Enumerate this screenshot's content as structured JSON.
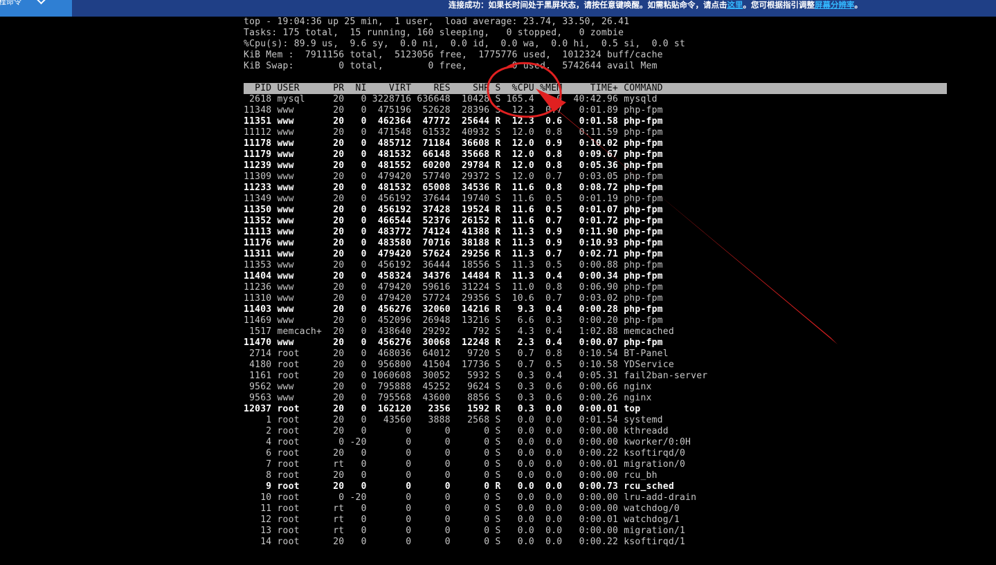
{
  "toolbar": {
    "command_button_label": "程命令",
    "notice_text": "连接成功：如果长时间处于黑屏状态，请按任意键唤醒。如需粘贴命令，请点击",
    "notice_link_here": "这里",
    "notice_mid": "。您可根据指引调整",
    "notice_link_resolution": "屏幕分辨率",
    "notice_end": "。"
  },
  "summary": [
    "top - 19:04:36 up 25 min,  1 user,  load average: 23.74, 33.50, 26.41",
    "Tasks: 175 total,  15 running, 160 sleeping,   0 stopped,   0 zombie",
    "%Cpu(s): 89.9 us,  9.6 sy,  0.0 ni,  0.0 id,  0.0 wa,  0.0 hi,  0.5 si,  0.0 st",
    "KiB Mem :  7911156 total,  5123056 free,  1775776 used,  1012324 buff/cache",
    "KiB Swap:        0 total,        0 free,        0 used.  5742644 avail Mem"
  ],
  "process_header": "  PID USER      PR  NI    VIRT    RES    SHR S  %CPU %MEM     TIME+ COMMAND",
  "processes": [
    {
      "text": " 2618 mysql     20   0 3228716 636648  10428 S 165.4  8.0  40:42.96 mysqld",
      "bold": false
    },
    {
      "text": "11348 www       20   0  475196  52628  28396 S  12.3  0.7   0:01.89 php-fpm",
      "bold": false
    },
    {
      "text": "11351 www       20   0  462364  47772  25644 R  12.3  0.6   0:01.58 php-fpm",
      "bold": true
    },
    {
      "text": "11112 www       20   0  471548  61532  40932 S  12.0  0.8   0:11.59 php-fpm",
      "bold": false
    },
    {
      "text": "11178 www       20   0  485712  71184  36608 R  12.0  0.9   0:10.02 php-fpm",
      "bold": true
    },
    {
      "text": "11179 www       20   0  481532  66148  35668 R  12.0  0.8   0:09.67 php-fpm",
      "bold": true
    },
    {
      "text": "11239 www       20   0  481552  60200  29784 R  12.0  0.8   0:05.36 php-fpm",
      "bold": true
    },
    {
      "text": "11309 www       20   0  479420  57740  29372 S  12.0  0.7   0:03.05 php-fpm",
      "bold": false
    },
    {
      "text": "11233 www       20   0  481532  65008  34536 R  11.6  0.8   0:08.72 php-fpm",
      "bold": true
    },
    {
      "text": "11349 www       20   0  456192  37644  19740 S  11.6  0.5   0:01.19 php-fpm",
      "bold": false
    },
    {
      "text": "11350 www       20   0  456192  37428  19524 R  11.6  0.5   0:01.07 php-fpm",
      "bold": true
    },
    {
      "text": "11352 www       20   0  466544  52376  26152 R  11.6  0.7   0:01.72 php-fpm",
      "bold": true
    },
    {
      "text": "11113 www       20   0  483772  74124  41388 R  11.3  0.9   0:11.90 php-fpm",
      "bold": true
    },
    {
      "text": "11176 www       20   0  483580  70716  38188 R  11.3  0.9   0:10.93 php-fpm",
      "bold": true
    },
    {
      "text": "11311 www       20   0  479420  57624  29256 R  11.3  0.7   0:02.71 php-fpm",
      "bold": true
    },
    {
      "text": "11353 www       20   0  456192  36444  18556 S  11.3  0.5   0:00.88 php-fpm",
      "bold": false
    },
    {
      "text": "11404 www       20   0  458324  34376  14484 R  11.3  0.4   0:00.34 php-fpm",
      "bold": true
    },
    {
      "text": "11236 www       20   0  479420  59616  31224 S  11.0  0.8   0:06.90 php-fpm",
      "bold": false
    },
    {
      "text": "11310 www       20   0  479420  57724  29356 S  10.6  0.7   0:03.02 php-fpm",
      "bold": false
    },
    {
      "text": "11403 www       20   0  456276  32060  14216 R   9.3  0.4   0:00.28 php-fpm",
      "bold": true
    },
    {
      "text": "11469 www       20   0  452096  26948  13216 S   6.6  0.3   0:00.20 php-fpm",
      "bold": false
    },
    {
      "text": " 1517 memcach+  20   0  438640  29292    792 S   4.3  0.4   1:02.88 memcached",
      "bold": false
    },
    {
      "text": "11470 www       20   0  456276  30068  12248 R   2.3  0.4   0:00.07 php-fpm",
      "bold": true
    },
    {
      "text": " 2714 root      20   0  468036  64012   9720 S   0.7  0.8   0:10.54 BT-Panel",
      "bold": false
    },
    {
      "text": " 4180 root      20   0  956800  41504  17736 S   0.7  0.5   0:10.58 YDService",
      "bold": false
    },
    {
      "text": " 1161 root      20   0 1060608  30052   5932 S   0.3  0.4   0:05.31 fail2ban-server",
      "bold": false
    },
    {
      "text": " 9562 www       20   0  795888  45252   9624 S   0.3  0.6   0:00.66 nginx",
      "bold": false
    },
    {
      "text": " 9563 www       20   0  795568  43600   8856 S   0.3  0.6   0:00.26 nginx",
      "bold": false
    },
    {
      "text": "12037 root      20   0  162120   2356   1592 R   0.3  0.0   0:00.01 top",
      "bold": true
    },
    {
      "text": "    1 root      20   0   43560   3888   2568 S   0.0  0.0   0:01.54 systemd",
      "bold": false
    },
    {
      "text": "    2 root      20   0       0      0      0 S   0.0  0.0   0:00.00 kthreadd",
      "bold": false
    },
    {
      "text": "    4 root       0 -20       0      0      0 S   0.0  0.0   0:00.00 kworker/0:0H",
      "bold": false
    },
    {
      "text": "    6 root      20   0       0      0      0 S   0.0  0.0   0:00.22 ksoftirqd/0",
      "bold": false
    },
    {
      "text": "    7 root      rt   0       0      0      0 S   0.0  0.0   0:00.01 migration/0",
      "bold": false
    },
    {
      "text": "    8 root      20   0       0      0      0 S   0.0  0.0   0:00.00 rcu_bh",
      "bold": false
    },
    {
      "text": "    9 root      20   0       0      0      0 R   0.0  0.0   0:00.73 rcu_sched",
      "bold": true
    },
    {
      "text": "   10 root       0 -20       0      0      0 S   0.0  0.0   0:00.00 lru-add-drain",
      "bold": false
    },
    {
      "text": "   11 root      rt   0       0      0      0 S   0.0  0.0   0:00.00 watchdog/0",
      "bold": false
    },
    {
      "text": "   12 root      rt   0       0      0      0 S   0.0  0.0   0:00.01 watchdog/1",
      "bold": false
    },
    {
      "text": "   13 root      rt   0       0      0      0 S   0.0  0.0   0:00.00 migration/1",
      "bold": false
    },
    {
      "text": "   14 root      20   0       0      0      0 S   0.0  0.0   0:00.22 ksoftirqd/1",
      "bold": false
    }
  ],
  "colors": {
    "topbar_bg": "#1f3f86",
    "button_bg": "#2f7fd3",
    "link": "#33b8ff",
    "terminal_bg": "#000000",
    "header_bg": "#b3b3b3",
    "annotation_red": "#e02020"
  },
  "icons": {
    "dropdown": "chevron-down-icon"
  }
}
